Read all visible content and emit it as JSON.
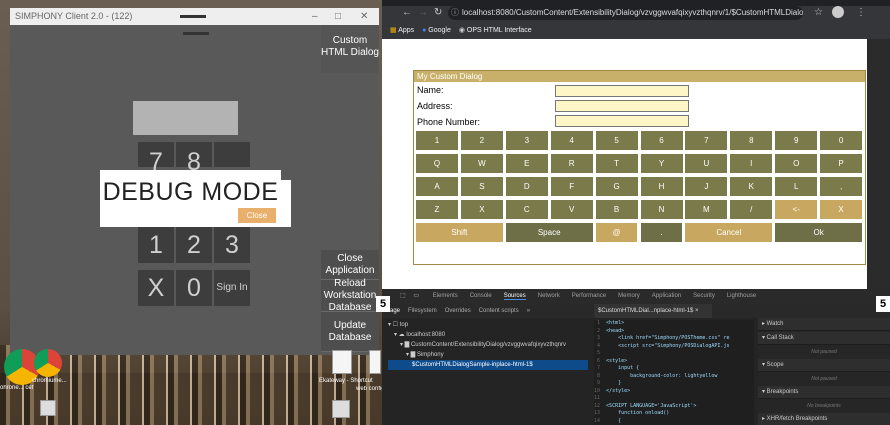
{
  "simphony": {
    "title": "SIMPHONY Client 2.0 - (122)",
    "minimize": "–",
    "maximize": "□",
    "close": "✕",
    "custom_html_dialog": "Custom HTML Dialog",
    "keys_top_partial": [
      "7",
      "8"
    ],
    "keys_row": [
      "1",
      "2",
      "3"
    ],
    "keys_bottom": [
      "X",
      "0",
      "Sign In"
    ],
    "debug_text": "DEBUG MODE",
    "close_label": "Close",
    "side_buttons": [
      "Close Application",
      "Reload Workstation Database",
      "Update Database"
    ]
  },
  "desktop": {
    "icons": [
      {
        "label": "ohrone... cef · wiki ·",
        "icon": "chrome-icon"
      },
      {
        "label": "chromiume...",
        "icon": "chrome-icon"
      },
      {
        "label": "Ekateway - Shortcut",
        "icon": "file-icon"
      },
      {
        "label": "web config - Shortcut",
        "icon": "file-icon"
      }
    ]
  },
  "chrome": {
    "url": "localhost:8080/CustomContent/ExtensibilityDialog/vzvggwvafqixyvzthqnrv/1/$CustomHTMLDialogSam...",
    "bookmarks": [
      "Apps",
      "Google",
      "OPS HTML Interface"
    ]
  },
  "dialog": {
    "title": "My Custom Dialog",
    "fields": [
      {
        "label": "Name:",
        "value": ""
      },
      {
        "label": "Address:",
        "value": ""
      },
      {
        "label": "Phone Number:",
        "value": ""
      }
    ],
    "rows": [
      [
        "1",
        "2",
        "3",
        "4",
        "5",
        "6",
        "7",
        "8",
        "9",
        "0"
      ],
      [
        "Q",
        "W",
        "E",
        "R",
        "T",
        "Y",
        "U",
        "I",
        "O",
        "P"
      ],
      [
        "A",
        "S",
        "D",
        "F",
        "G",
        "H",
        "J",
        "K",
        "L",
        ","
      ],
      [
        "Z",
        "X",
        "C",
        "V",
        "B",
        "N",
        "M",
        "/",
        "<-",
        "X"
      ]
    ],
    "bottom_keys": [
      "Shift",
      "Space",
      "@",
      ".",
      "Cancel",
      "Ok"
    ]
  },
  "devtools": {
    "tabs": [
      "Elements",
      "Console",
      "Sources",
      "Network",
      "Performance",
      "Memory",
      "Application",
      "Security",
      "Lighthouse"
    ],
    "active_tab": "Sources",
    "subtabs": [
      "Page",
      "Filesystem",
      "Overrides",
      "Content scripts",
      "»"
    ],
    "file_tab": "$CustomHTMLDial...nplace-html-1$ ×",
    "tree": [
      "▾ ☐ top",
      "▾ ☁ localhost:8080",
      "▾ ▇ CustomContent/ExtensibilityDialog/vzvggwvafqixyvzthqnrv",
      "▾ ▇ Simphony",
      "$CustomHTMLDialogSample-inplace-html-1$"
    ],
    "code_lines": [
      "<html>",
      "<head>",
      "    <link href=\"Simphony/POSTheme.css\" re",
      "    <script src=\"Simphony/POSDialogAPI.js",
      "",
      "<style>",
      "    input {",
      "        background-color: lightyellow",
      "    }",
      "</style>",
      "",
      "<SCRIPT LANGUAGE='JavaScript'>",
      "    function onload()",
      "    {"
    ],
    "right_sections": [
      {
        "header": "▸ Watch"
      },
      {
        "header": "▾ Call Stack",
        "note": "Not paused"
      },
      {
        "header": "▾ Scope",
        "note": "Not paused"
      },
      {
        "header": "▾ Breakpoints",
        "note": "No breakpoints"
      },
      {
        "header": "▸ XHR/fetch Breakpoints"
      }
    ]
  },
  "colors": {
    "dialog_key": "#7a7a4a",
    "dialog_key_alt": "#c8a860",
    "input_bg": "#fff6c8",
    "close_button": "#e8b06a"
  }
}
